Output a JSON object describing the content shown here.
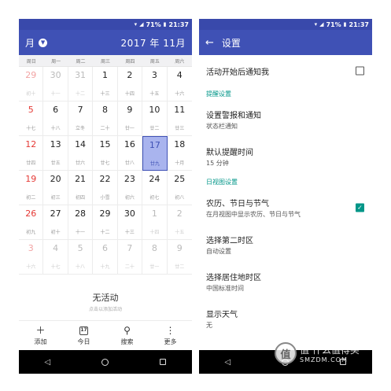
{
  "status_bar": {
    "battery": "71%",
    "time": "21:37",
    "icons": [
      "wifi-icon",
      "signal-icon",
      "battery-icon"
    ]
  },
  "calendar_app": {
    "view_label": "月",
    "year_month": "2017 年 11月",
    "weekdays": [
      "周日",
      "周一",
      "周二",
      "周三",
      "周四",
      "周五",
      "周六"
    ],
    "weeks": [
      [
        {
          "d": "29",
          "l": "初十",
          "other": true
        },
        {
          "d": "30",
          "l": "十一",
          "other": true
        },
        {
          "d": "31",
          "l": "十二",
          "other": true
        },
        {
          "d": "1",
          "l": "十三"
        },
        {
          "d": "2",
          "l": "十四"
        },
        {
          "d": "3",
          "l": "十五"
        },
        {
          "d": "4",
          "l": "十六"
        }
      ],
      [
        {
          "d": "5",
          "l": "十七"
        },
        {
          "d": "6",
          "l": "十八"
        },
        {
          "d": "7",
          "l": "立冬"
        },
        {
          "d": "8",
          "l": "二十"
        },
        {
          "d": "9",
          "l": "廿一"
        },
        {
          "d": "10",
          "l": "廿二"
        },
        {
          "d": "11",
          "l": "廿三"
        }
      ],
      [
        {
          "d": "12",
          "l": "廿四"
        },
        {
          "d": "13",
          "l": "廿五"
        },
        {
          "d": "14",
          "l": "廿六"
        },
        {
          "d": "15",
          "l": "廿七"
        },
        {
          "d": "16",
          "l": "廿八"
        },
        {
          "d": "17",
          "l": "廿九",
          "today": true
        },
        {
          "d": "18",
          "l": "十月"
        }
      ],
      [
        {
          "d": "19",
          "l": "初二"
        },
        {
          "d": "20",
          "l": "初三"
        },
        {
          "d": "21",
          "l": "初四"
        },
        {
          "d": "22",
          "l": "小雪"
        },
        {
          "d": "23",
          "l": "初六"
        },
        {
          "d": "24",
          "l": "初七"
        },
        {
          "d": "25",
          "l": "初八"
        }
      ],
      [
        {
          "d": "26",
          "l": "初九"
        },
        {
          "d": "27",
          "l": "初十"
        },
        {
          "d": "28",
          "l": "十一"
        },
        {
          "d": "29",
          "l": "十二"
        },
        {
          "d": "30",
          "l": "十三"
        },
        {
          "d": "1",
          "l": "十四",
          "other": true
        },
        {
          "d": "2",
          "l": "十五",
          "other": true
        }
      ],
      [
        {
          "d": "3",
          "l": "十六",
          "other": true
        },
        {
          "d": "4",
          "l": "十七",
          "other": true
        },
        {
          "d": "5",
          "l": "十八",
          "other": true
        },
        {
          "d": "6",
          "l": "十九",
          "other": true
        },
        {
          "d": "7",
          "l": "二十",
          "other": true
        },
        {
          "d": "8",
          "l": "廿一",
          "other": true
        },
        {
          "d": "9",
          "l": "廿二",
          "other": true
        }
      ]
    ],
    "no_event": {
      "title": "无活动",
      "hint": "点击以添加活动"
    },
    "bottom_nav": [
      {
        "icon": "plus-icon",
        "label": "添加"
      },
      {
        "icon": "calendar-today-icon",
        "label": "今日",
        "icon_text": "17"
      },
      {
        "icon": "search-icon",
        "label": "搜索"
      },
      {
        "icon": "more-vert-icon",
        "label": "更多"
      }
    ]
  },
  "settings_app": {
    "title": "设置",
    "rows": [
      {
        "type": "item",
        "title": "活动开始后通知我",
        "checkbox": "off"
      },
      {
        "type": "section",
        "title": "提醒设置"
      },
      {
        "type": "item",
        "title": "设置警报和通知",
        "sub": "状态栏通知"
      },
      {
        "type": "item",
        "title": "默认提醒时间",
        "sub": "15 分钟"
      },
      {
        "type": "section",
        "title": "日视图设置"
      },
      {
        "type": "item",
        "title": "农历、节日与节气",
        "sub": "在月视图中显示农历、节日与节气",
        "checkbox": "on"
      },
      {
        "type": "item",
        "title": "选择第二时区",
        "sub": "自动设置"
      },
      {
        "type": "item",
        "title": "选择居住地时区",
        "sub": "中国标准时间"
      },
      {
        "type": "item",
        "title": "显示天气",
        "sub": "无"
      }
    ]
  },
  "watermark": {
    "line1": "值 什么值得买",
    "line2": "SMZDM.COM"
  },
  "colors": {
    "primary": "#3f51b5",
    "status_bar": "#3949ab",
    "teal": "#009688",
    "sunday_red": "#e53935",
    "today_fill": "#a9b4ee"
  }
}
